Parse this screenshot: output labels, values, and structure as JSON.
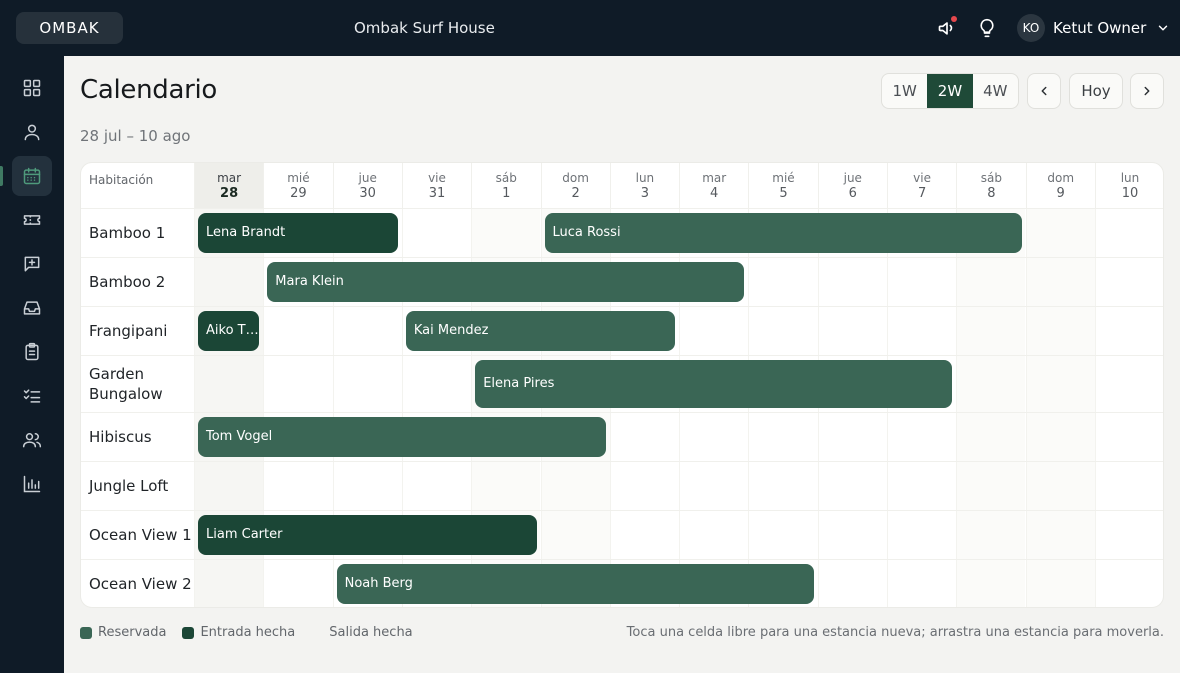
{
  "header": {
    "logo": "OMBAK",
    "property": "Ombak Surf House",
    "user_initials": "KO",
    "user_name": "Ketut Owner"
  },
  "sidebar": {
    "items": [
      {
        "icon": "grid-icon"
      },
      {
        "icon": "user-icon"
      },
      {
        "icon": "calendar-icon",
        "active": true
      },
      {
        "icon": "ticket-icon"
      },
      {
        "icon": "message-plus-icon"
      },
      {
        "icon": "inbox-icon"
      },
      {
        "icon": "clipboard-icon"
      },
      {
        "icon": "checklist-icon"
      },
      {
        "icon": "users-icon"
      },
      {
        "icon": "bar-chart-icon"
      }
    ]
  },
  "page": {
    "title": "Calendario",
    "range": "28 jul – 10 ago"
  },
  "view_toggle": [
    "1W",
    "2W",
    "4W"
  ],
  "view_selected": "2W",
  "today_label": "Hoy",
  "calendar": {
    "room_header": "Habitación",
    "days": [
      {
        "name": "mar",
        "num": "28",
        "today": true
      },
      {
        "name": "mié",
        "num": "29"
      },
      {
        "name": "jue",
        "num": "30"
      },
      {
        "name": "vie",
        "num": "31"
      },
      {
        "name": "sáb",
        "num": "1"
      },
      {
        "name": "dom",
        "num": "2"
      },
      {
        "name": "lun",
        "num": "3"
      },
      {
        "name": "mar",
        "num": "4"
      },
      {
        "name": "mié",
        "num": "5"
      },
      {
        "name": "jue",
        "num": "6"
      },
      {
        "name": "vie",
        "num": "7"
      },
      {
        "name": "sáb",
        "num": "8"
      },
      {
        "name": "dom",
        "num": "9"
      },
      {
        "name": "lun",
        "num": "10"
      }
    ],
    "rooms": [
      {
        "name": "Bamboo 1"
      },
      {
        "name": "Bamboo 2"
      },
      {
        "name": "Frangipani"
      },
      {
        "name": "Garden Bungalow"
      },
      {
        "name": "Hibiscus"
      },
      {
        "name": "Jungle Loft"
      },
      {
        "name": "Ocean View 1"
      },
      {
        "name": "Ocean View 2"
      }
    ],
    "bookings": [
      {
        "guest": "Lena Brandt",
        "room": 0,
        "start": 0,
        "end": 3,
        "status": "in"
      },
      {
        "guest": "Luca Rossi",
        "room": 0,
        "start": 5,
        "end": 12,
        "status": "reserved"
      },
      {
        "guest": "Mara Klein",
        "room": 1,
        "start": 1,
        "end": 8,
        "status": "reserved"
      },
      {
        "guest": "Aiko T…",
        "room": 2,
        "start": 0,
        "end": 1,
        "status": "in"
      },
      {
        "guest": "Kai Mendez",
        "room": 2,
        "start": 3,
        "end": 7,
        "status": "reserved"
      },
      {
        "guest": "Elena Pires",
        "room": 3,
        "start": 4,
        "end": 11,
        "status": "reserved"
      },
      {
        "guest": "Tom Vogel",
        "room": 4,
        "start": 0,
        "end": 6,
        "status": "reserved"
      },
      {
        "guest": "Liam Carter",
        "room": 6,
        "start": 0,
        "end": 5,
        "status": "in"
      },
      {
        "guest": "Noah Berg",
        "room": 7,
        "start": 2,
        "end": 9,
        "status": "reserved"
      }
    ]
  },
  "legend": {
    "reserved": "Reservada",
    "checked_in": "Entrada hecha",
    "checked_out": "Salida hecha"
  },
  "colors": {
    "reserved": "#3a6655",
    "checked_in": "#1b4636",
    "accent": "#1f4a38"
  },
  "hint": "Toca una celda libre para una estancia nueva; arrastra una estancia para moverla."
}
